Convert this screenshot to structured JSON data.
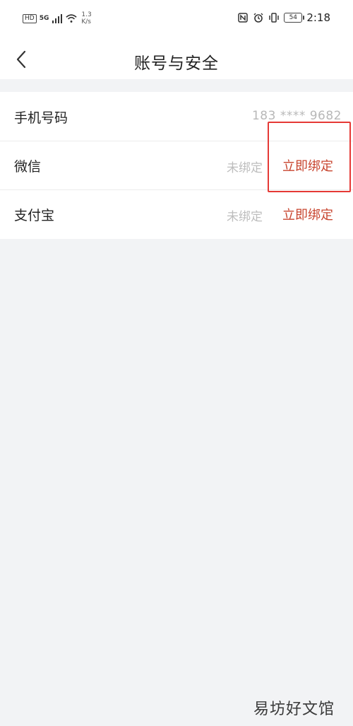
{
  "status_bar": {
    "hd_label": "HD",
    "net_label": "5G",
    "speed_value": "1.3",
    "speed_unit": "K/s",
    "battery": "54",
    "time": "2:18"
  },
  "nav": {
    "title": "账号与安全"
  },
  "rows": [
    {
      "label": "手机号码",
      "value": "183 **** 9682"
    },
    {
      "label": "微信",
      "status": "未绑定",
      "action": "立即绑定"
    },
    {
      "label": "支付宝",
      "status": "未绑定",
      "action": "立即绑定"
    }
  ],
  "watermark": "易坊好文馆",
  "colors": {
    "action": "#c8452f",
    "highlight": "#e53935",
    "background": "#f2f3f5"
  }
}
